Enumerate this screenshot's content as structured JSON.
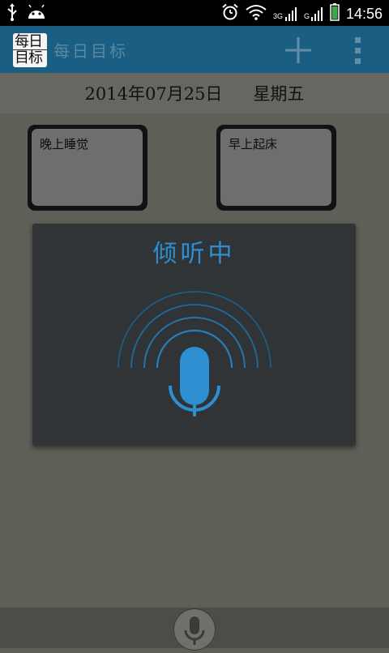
{
  "status": {
    "time": "14:56",
    "network_3g": "3G",
    "network_g": "G"
  },
  "app_bar": {
    "logo_top": "每日",
    "logo_bottom": "目标",
    "title": "每日目标"
  },
  "date_row": {
    "date": "2014年07月25日",
    "weekday": "星期五"
  },
  "goals": [
    {
      "label": "晚上睡觉"
    },
    {
      "label": "早上起床"
    }
  ],
  "voice": {
    "title": "倾听中"
  },
  "colors": {
    "accent": "#2b8fd1",
    "action_bar": "#1a5f83"
  }
}
